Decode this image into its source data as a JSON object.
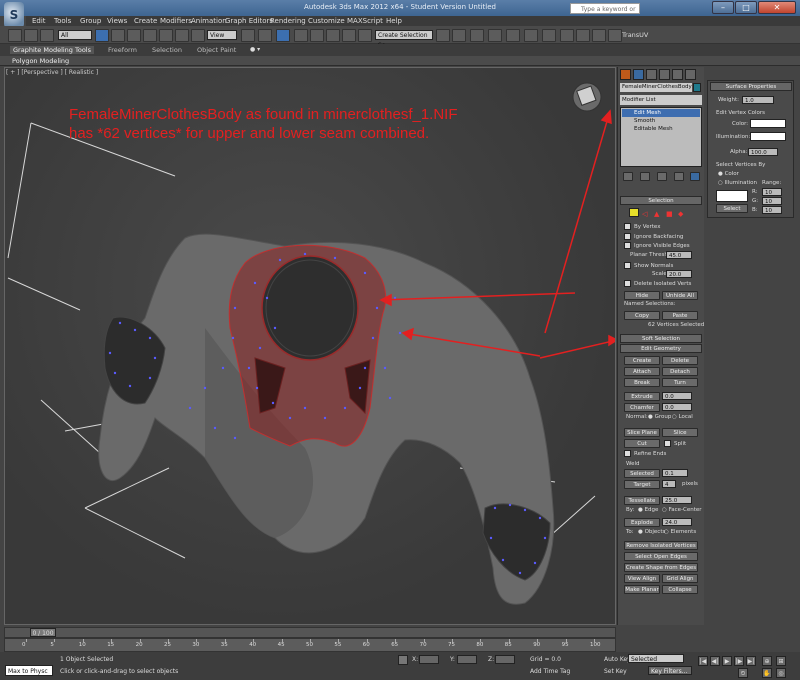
{
  "window": {
    "title": "Autodesk 3ds Max 2012 x64 - Student Version    Untitled",
    "search_placeholder": "Type a keyword or phrase",
    "logo_glyph": "S"
  },
  "menu": [
    "Edit",
    "Tools",
    "Group",
    "Views",
    "Create",
    "Modifiers",
    "Animation",
    "Graph Editors",
    "Rendering",
    "Customize",
    "MAXScript",
    "Help"
  ],
  "toolbar": {
    "selection_filter": "All",
    "ref_coord": "View",
    "named_selection": "Create Selection Se",
    "trans_label": "TransUV"
  },
  "ribbon": {
    "tabs": [
      "Graphite Modeling Tools",
      "Freeform",
      "Selection",
      "Object Paint"
    ],
    "sub": "Polygon Modeling"
  },
  "viewport": {
    "label": "[ + ] [Perspective ] [ Realistic ]",
    "annotation_line1": "FemaleMinerClothesBody as found in minerclothesf_1.NIF",
    "annotation_line2": "has *62 vertices* for upper and lower seam combined."
  },
  "command_panel": {
    "object_name": "FemaleMinerClothesBody",
    "modifier_list": "Modifier List",
    "stack": [
      "Edit Mesh",
      "Smooth",
      "Editable Mesh"
    ],
    "selection": {
      "title": "Selection",
      "by_vertex": "By Vertex",
      "ignore_backfacing": "Ignore Backfacing",
      "ignore_visible_edges": "Ignore Visible Edges",
      "planar_thresh_label": "Planar Thresh:",
      "planar_thresh_value": "45.0",
      "show_normals": "Show Normals",
      "scale_label": "Scale:",
      "scale_value": "20.0",
      "delete_isolated": "Delete Isolated Verts",
      "hide": "Hide",
      "unhide_all": "Unhide All",
      "named_selections": "Named Selections:",
      "copy": "Copy",
      "paste": "Paste",
      "status": "62 Vertices Selected"
    },
    "soft_selection": "Soft Selection",
    "edit_geometry": {
      "title": "Edit Geometry",
      "create": "Create",
      "delete": "Delete",
      "attach": "Attach",
      "detach": "Detach",
      "break": "Break",
      "turn": "Turn",
      "extrude": "Extrude",
      "extrude_value": "0.0",
      "chamfer": "Chamfer",
      "chamfer_value": "0.0",
      "normal_label": "Normal:",
      "group": "Group",
      "local": "Local",
      "slice_plane": "Slice Plane",
      "slice": "Slice",
      "cut": "Cut",
      "split": "Split",
      "refine_ends": "Refine Ends",
      "weld": "Weld",
      "selected": "Selected",
      "selected_value": "0.1",
      "target": "Target",
      "target_value": "4",
      "pixels": "pixels",
      "tessellate": "Tessellate",
      "tessellate_value": "25.0",
      "by_label": "By:",
      "edge": "Edge",
      "face_center": "Face-Center",
      "explode": "Explode",
      "explode_value": "24.0",
      "to_label": "To:",
      "objects": "Objects",
      "elements": "Elements",
      "remove_isolated": "Remove Isolated Vertices",
      "select_open_edges": "Select Open Edges",
      "create_shape": "Create Shape from Edges",
      "view_align": "View Align",
      "grid_align": "Grid Align",
      "make_planar": "Make Planar",
      "collapse": "Collapse"
    }
  },
  "surface_panel": {
    "title": "Surface Properties",
    "weight_label": "Weight:",
    "weight_value": "1.0",
    "edit_vertex_colors": "Edit Vertex Colors",
    "color_label": "Color:",
    "illumination_label": "Illumination:",
    "alpha_label": "Alpha:",
    "alpha_value": "100.0",
    "select_vertices_by": "Select Vertices By",
    "color_radio": "Color",
    "illum_radio": "Illumination",
    "range_label": "Range:",
    "r_label": "R:",
    "r_value": "10",
    "g_label": "G:",
    "g_value": "10",
    "b_label": "B:",
    "b_value": "10",
    "select_btn": "Select"
  },
  "timeline": {
    "frame": "0 / 100",
    "ticks": [
      "0",
      "5",
      "10",
      "15",
      "20",
      "25",
      "30",
      "35",
      "40",
      "45",
      "50",
      "55",
      "60",
      "65",
      "70",
      "75",
      "80",
      "85",
      "90",
      "95",
      "100"
    ]
  },
  "status": {
    "maxscript": "Max to Physc",
    "objects": "1 Object Selected",
    "hint": "Click or click-and-drag to select objects",
    "x_label": "X:",
    "y_label": "Y:",
    "z_label": "Z:",
    "grid": "Grid = 0.0",
    "add_time_tag": "Add Time Tag",
    "auto_key": "Auto Key",
    "selected_dropdown": "Selected",
    "set_key": "Set Key",
    "key_filters": "Key Filters..."
  },
  "colors": {
    "annotation": "#e32020",
    "vertex": "#5b5bff",
    "selected_face": "#8a2222",
    "object_color": "#1f7a8c"
  }
}
